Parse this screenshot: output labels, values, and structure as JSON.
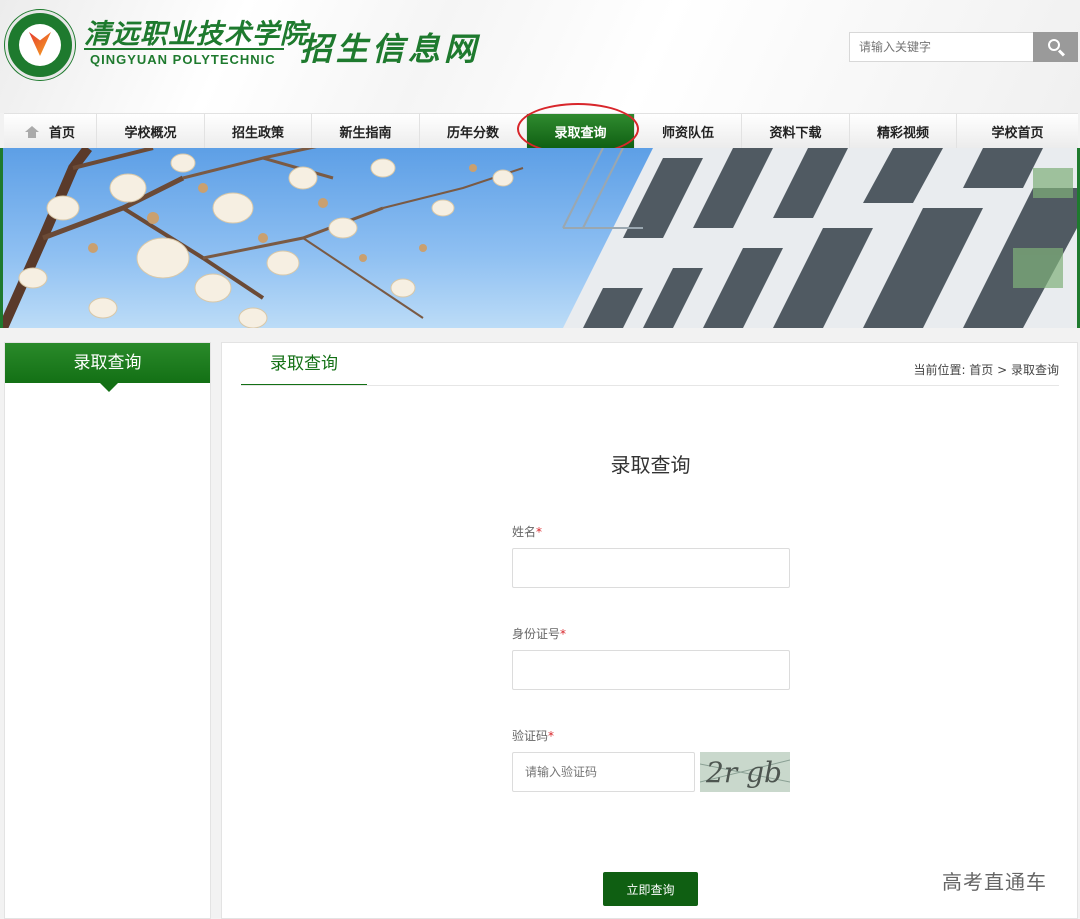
{
  "header": {
    "school_name_cn": "清远职业技术学院",
    "school_name_en": "QINGYUAN  POLYTECHNIC",
    "site_title": "招生信息网",
    "search_placeholder": "请输入关键字"
  },
  "nav": {
    "items": [
      {
        "label": "首页",
        "icon": "home-icon"
      },
      {
        "label": "学校概况"
      },
      {
        "label": "招生政策"
      },
      {
        "label": "新生指南"
      },
      {
        "label": "历年分数"
      },
      {
        "label": "录取查询",
        "active": true
      },
      {
        "label": "师资队伍"
      },
      {
        "label": "资料下载"
      },
      {
        "label": "精彩视频"
      },
      {
        "label": "学校首页"
      }
    ]
  },
  "sidebar": {
    "title": "录取查询"
  },
  "main": {
    "tab_label": "录取查询",
    "breadcrumb": "当前位置: 首页 > 录取查询",
    "form_title": "录取查询",
    "fields": {
      "name_label": "姓名",
      "id_label": "身份证号",
      "captcha_label": "验证码",
      "captcha_placeholder": "请输入验证码",
      "required_mark": "*"
    },
    "captcha_text": "2r gb",
    "submit_label": "立即查询"
  },
  "watermark": "高考直通车",
  "colors": {
    "brand_green": "#137015",
    "dark_green": "#0f5f12",
    "highlight_red": "#d8262b"
  }
}
